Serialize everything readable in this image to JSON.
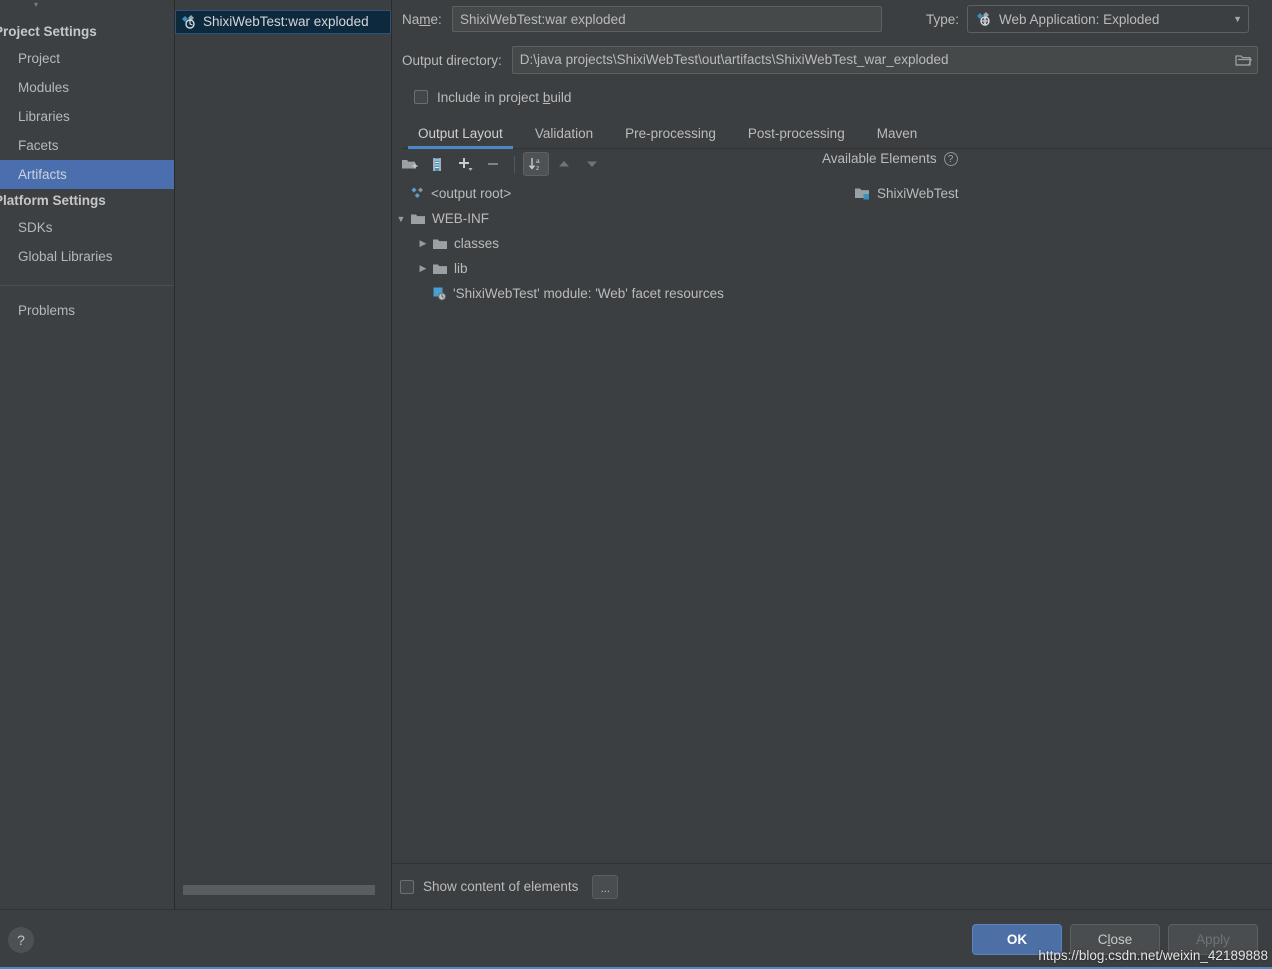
{
  "sidebar": {
    "groups": [
      {
        "title": "Project Settings",
        "items": [
          {
            "label": "Project",
            "selected": false
          },
          {
            "label": "Modules",
            "selected": false
          },
          {
            "label": "Libraries",
            "selected": false
          },
          {
            "label": "Facets",
            "selected": false
          },
          {
            "label": "Artifacts",
            "selected": true
          }
        ]
      },
      {
        "title": "Platform Settings",
        "items": [
          {
            "label": "SDKs",
            "selected": false
          },
          {
            "label": "Global Libraries",
            "selected": false
          }
        ]
      }
    ],
    "problems_label": "Problems"
  },
  "artifacts_list": {
    "items": [
      {
        "label": "ShixiWebTest:war exploded",
        "icon": "artifact-icon",
        "selected": true
      }
    ]
  },
  "form": {
    "name_label": "Na",
    "name_label_accel": "m",
    "name_label_tail": "e:",
    "name_value": "ShixiWebTest:war exploded",
    "type_label": "Type:",
    "type_value": "Web Application: Exploded",
    "output_dir_label": "Output directory:",
    "output_dir_value": "D:\\java projects\\ShixiWebTest\\out\\artifacts\\ShixiWebTest_war_exploded",
    "include_build_label_head": "Include in project ",
    "include_build_label_accel": "b",
    "include_build_label_tail": "uild",
    "include_build_checked": false
  },
  "tabs": [
    {
      "label": "Output Layout",
      "active": true
    },
    {
      "label": "Validation",
      "active": false
    },
    {
      "label": "Pre-processing",
      "active": false
    },
    {
      "label": "Post-processing",
      "active": false
    },
    {
      "label": "Maven",
      "active": false
    }
  ],
  "toolbar": {
    "buttons": [
      {
        "name": "add-directory-icon",
        "pressed": false
      },
      {
        "name": "add-archive-icon",
        "pressed": false
      },
      {
        "name": "plus-dropdown-icon",
        "pressed": false
      },
      {
        "name": "minus-icon",
        "pressed": false
      },
      {
        "name": "sort-az-icon",
        "pressed": true
      },
      {
        "name": "move-up-icon",
        "pressed": false
      },
      {
        "name": "move-down-icon",
        "pressed": false
      }
    ],
    "available_elements_label": "Available Elements",
    "help_badge": "?"
  },
  "output_tree": [
    {
      "label": "<output root>",
      "icon": "output-root-icon",
      "indent": 0,
      "twisty": "none"
    },
    {
      "label": "WEB-INF",
      "icon": "folder-icon",
      "indent": 0,
      "twisty": "expanded"
    },
    {
      "label": "classes",
      "icon": "folder-icon",
      "indent": 1,
      "twisty": "collapsed"
    },
    {
      "label": "lib",
      "icon": "folder-icon",
      "indent": 1,
      "twisty": "collapsed"
    },
    {
      "label": "'ShixiWebTest' module: 'Web' facet resources",
      "icon": "facet-resources-icon",
      "indent": 1,
      "twisty": "none"
    }
  ],
  "available_elements_tree": [
    {
      "label": "ShixiWebTest",
      "icon": "module-icon"
    }
  ],
  "bottom_options": {
    "show_content_label": "Show content of elements",
    "show_content_checked": false,
    "more_button_label": "..."
  },
  "footer": {
    "help_label": "?",
    "ok_label": "OK",
    "close_label_head": "C",
    "close_label_accel": "l",
    "close_label_tail": "ose",
    "apply_label": "Apply",
    "apply_disabled": true,
    "watermark": "https://blog.csdn.net/weixin_42189888"
  },
  "colors": {
    "accent": "#4a88c7",
    "selection": "#4b6eaf",
    "list_selection": "#0d293e",
    "panel_bg": "#3c3f41",
    "sidebar_bg": "#3c4043",
    "text": "#bbbbbb"
  }
}
